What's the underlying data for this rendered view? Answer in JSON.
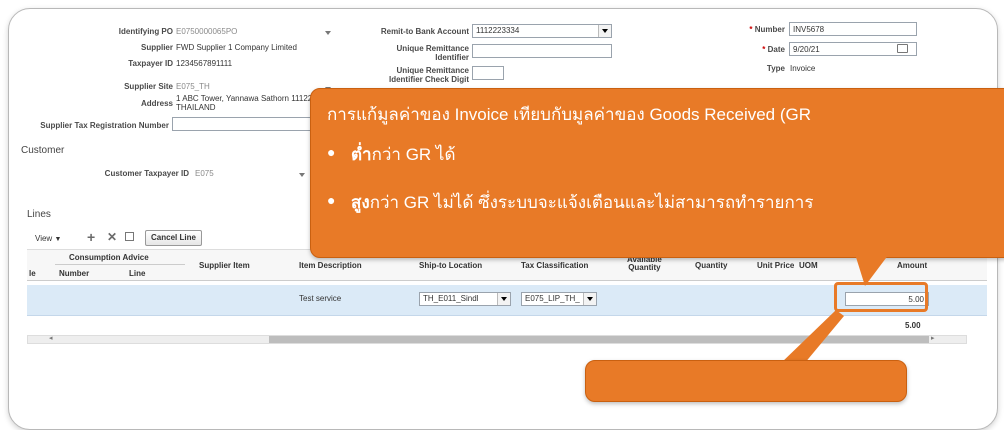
{
  "header_left": {
    "identifying_po_label": "Identifying PO",
    "identifying_po_value": "E0750000065PO",
    "supplier_label": "Supplier",
    "supplier_value": "FWD Supplier 1 Company Limited",
    "taxpayer_id_label": "Taxpayer ID",
    "taxpayer_id_value": "1234567891111",
    "supplier_site_label": "Supplier Site",
    "supplier_site_value": "E075_TH",
    "address_label": "Address",
    "address_line1": "1 ABC Tower, Yannawa Sathorn 11122",
    "address_line2": "THAILAND",
    "supplier_tax_reg_label": "Supplier Tax Registration Number",
    "supplier_tax_reg_value": ""
  },
  "header_mid": {
    "remit_bank_label": "Remit-to Bank Account",
    "remit_bank_value": "1112223334",
    "unique_remit_label_1": "Unique Remittance",
    "unique_remit_label_2": "Identifier",
    "unique_remit_value": "",
    "unique_remit_cd_label_1": "Unique Remittance",
    "unique_remit_cd_label_2": "Identifier Check Digit",
    "unique_remit_cd_value": ""
  },
  "header_right": {
    "number_label": "Number",
    "number_value": "INV5678",
    "date_label": "Date",
    "date_value": "9/20/21",
    "type_label": "Type",
    "type_value": "Invoice",
    "required_mark": "*"
  },
  "customer": {
    "section_title": "Customer",
    "taxpayer_label": "Customer Taxpayer ID",
    "taxpayer_value": "E075"
  },
  "lines": {
    "section_title": "Lines",
    "view_label": "View",
    "cancel_line_label": "Cancel Line",
    "headers": {
      "consumption_advice": "Consumption Advice",
      "line_partial": "le",
      "number": "Number",
      "line": "Line",
      "supplier_item": "Supplier Item",
      "item_description": "Item Description",
      "ship_to_location": "Ship-to Location",
      "tax_classification": "Tax Classification",
      "available_quantity_1": "Available",
      "available_quantity_2": "Quantity",
      "quantity": "Quantity",
      "unit_price": "Unit Price",
      "uom": "UOM",
      "amount": "Amount"
    },
    "row": {
      "item_description": "Test service",
      "ship_to_location": "TH_E011_Sindl",
      "tax_classification": "E075_LIP_TH_",
      "amount": "5.00"
    },
    "total": "5.00"
  },
  "callout_top": {
    "title": "การแก้มูลค่าของ Invoice เทียบกับมูลค่าของ Goods Received (GR",
    "bullet1_bold": "ต่ำ",
    "bullet1_rest": "กว่า GR ได้",
    "bullet2_bold": "สูง",
    "bullet2_rest": "กว่า GR ไม่ได้ ซึ่งระบบจะแจ้งเตือนและไม่สามารถทำรายการ"
  },
  "colors": {
    "callout": "#e87a27",
    "selected_row": "#dbeaf7"
  }
}
